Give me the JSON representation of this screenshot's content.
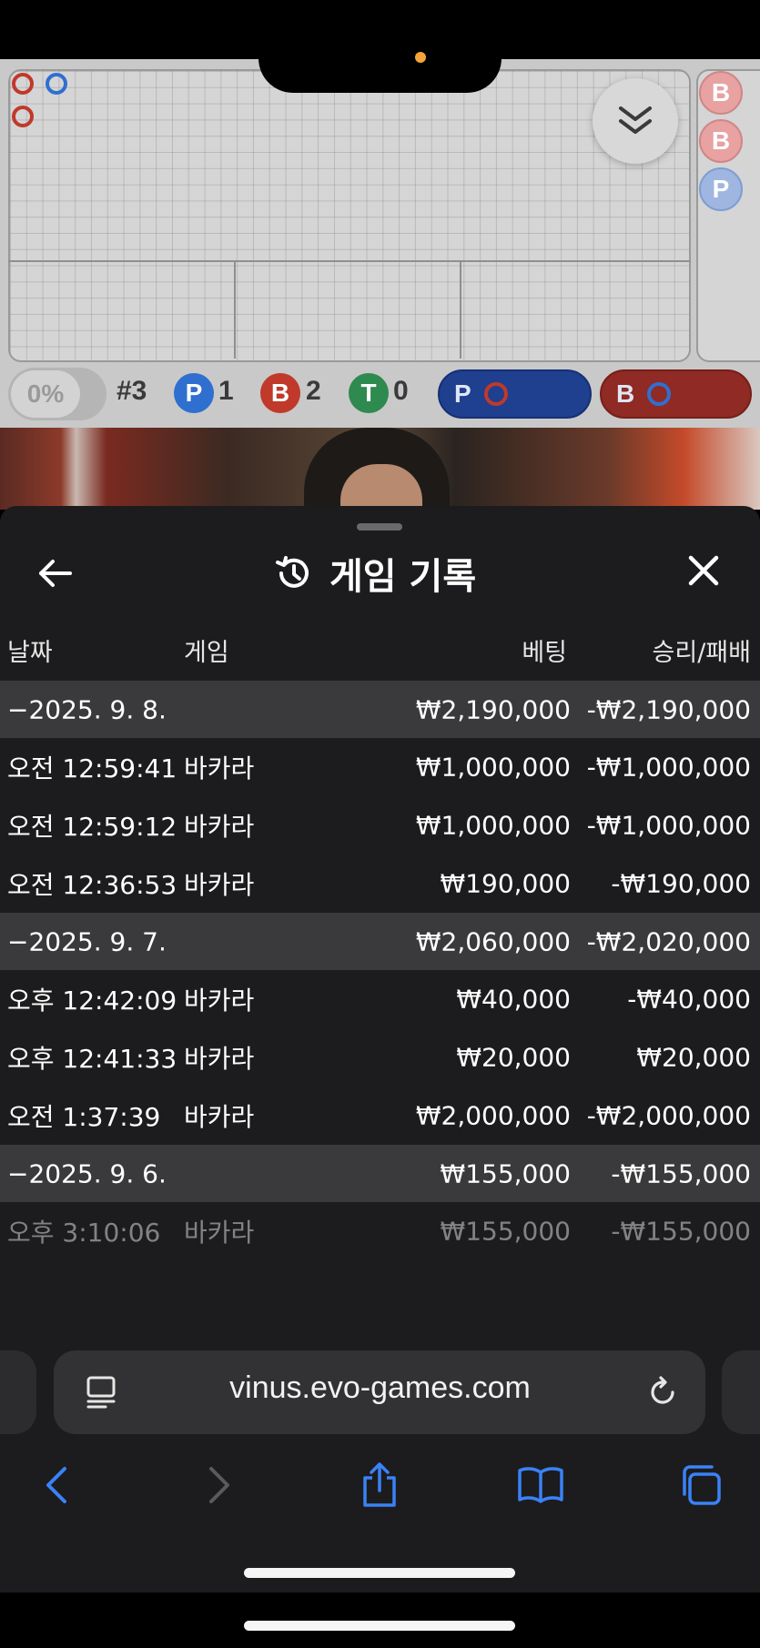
{
  "game": {
    "stats": {
      "percent": "0%",
      "round": "#3",
      "player_letter": "P",
      "player_count": "1",
      "banker_letter": "B",
      "banker_count": "2",
      "tie_letter": "T",
      "tie_count": "0"
    },
    "predict": {
      "player_label": "P",
      "banker_label": "B"
    },
    "side_road": [
      "B",
      "B",
      "P"
    ]
  },
  "sheet": {
    "title": "게임 기록",
    "columns": {
      "date": "날짜",
      "game": "게임",
      "bet": "베팅",
      "win_loss": "승리/패배"
    },
    "groups": [
      {
        "date": "−2025. 9. 8.",
        "bet": "₩2,190,000",
        "result": "-₩2,190,000",
        "rows": [
          {
            "time": "오전 12:59:41",
            "game": "바카라",
            "bet": "₩1,000,000",
            "result": "-₩1,000,000"
          },
          {
            "time": "오전 12:59:12",
            "game": "바카라",
            "bet": "₩1,000,000",
            "result": "-₩1,000,000"
          },
          {
            "time": "오전 12:36:53",
            "game": "바카라",
            "bet": "₩190,000",
            "result": "-₩190,000"
          }
        ]
      },
      {
        "date": "−2025. 9. 7.",
        "bet": "₩2,060,000",
        "result": "-₩2,020,000",
        "rows": [
          {
            "time": "오후 12:42:09",
            "game": "바카라",
            "bet": "₩40,000",
            "result": "-₩40,000"
          },
          {
            "time": "오후 12:41:33",
            "game": "바카라",
            "bet": "₩20,000",
            "result": "₩20,000"
          },
          {
            "time": "오전 1:37:39",
            "game": "바카라",
            "bet": "₩2,000,000",
            "result": "-₩2,000,000"
          }
        ]
      },
      {
        "date": "−2025. 9. 6.",
        "bet": "₩155,000",
        "result": "-₩155,000",
        "rows": [
          {
            "time": "오후 3:10:06",
            "game": "바카라",
            "bet": "₩155,000",
            "result": "-₩155,000"
          }
        ]
      }
    ]
  },
  "browser": {
    "url": "vinus.evo-games.com"
  },
  "colors": {
    "banker_red": "#c0392b",
    "player_blue": "#2f6fd0",
    "tie_green": "#2e8a4e",
    "accent_blue": "#3a82f7"
  }
}
